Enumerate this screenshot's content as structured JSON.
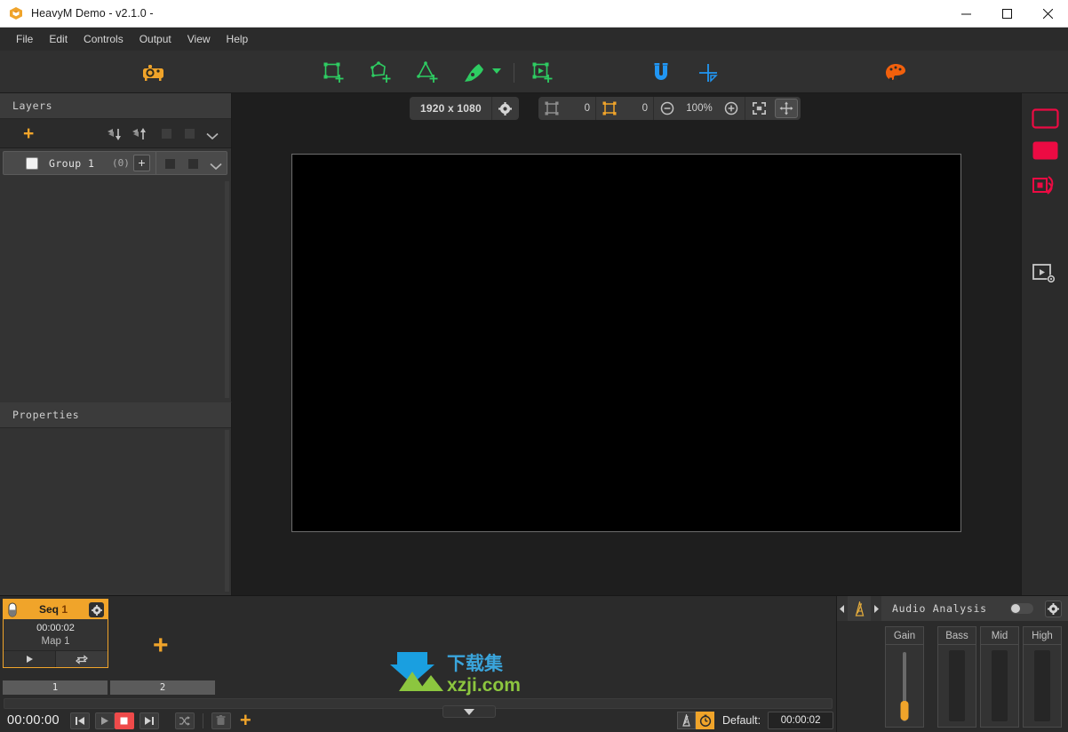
{
  "window": {
    "title": "HeavyM Demo - v2.1.0 -",
    "logo_icon": "heavym-logo-icon",
    "controls": [
      {
        "name": "minimize-button",
        "icon": "minimize-icon"
      },
      {
        "name": "maximize-button",
        "icon": "maximize-icon"
      },
      {
        "name": "close-button",
        "icon": "close-icon"
      }
    ]
  },
  "menubar": {
    "items": [
      {
        "label": "File"
      },
      {
        "label": "Edit"
      },
      {
        "label": "Controls"
      },
      {
        "label": "Output"
      },
      {
        "label": "View"
      },
      {
        "label": "Help"
      }
    ]
  },
  "toolbar": {
    "items": [
      {
        "name": "projector-button",
        "icon": "projector-icon",
        "color": "#f0a42a"
      },
      {
        "name": "add-rectangle-button",
        "icon": "rectangle-plus-icon",
        "color": "#2ecc62"
      },
      {
        "name": "add-polygon-button",
        "icon": "polygon-plus-icon",
        "color": "#2ecc62"
      },
      {
        "name": "add-triangle-button",
        "icon": "triangle-plus-icon",
        "color": "#2ecc62"
      },
      {
        "name": "pen-tool-button",
        "icon": "pen-icon",
        "color": "#2ecc62"
      },
      {
        "name": "pen-tool-dropdown",
        "icon": "chevron-down-icon",
        "color": "#2ecc62"
      },
      {
        "name": "add-media-surface-button",
        "icon": "media-rectangle-plus-icon",
        "color": "#2ecc62"
      },
      {
        "name": "snap-button",
        "icon": "magnet-icon",
        "color": "#2196f3"
      },
      {
        "name": "guides-button",
        "icon": "crosshair-icon",
        "color": "#2196f3"
      },
      {
        "name": "palette-button",
        "icon": "palette-icon",
        "color": "#f2600c"
      }
    ]
  },
  "layers_panel": {
    "title": "Layers",
    "toolbar": {
      "add_label": "+",
      "move_down_icon": "send-backward-icon",
      "move_up_icon": "bring-forward-icon",
      "toggle_a_icon": "square-toggle-icon",
      "toggle_b_icon": "square-toggle-icon",
      "expand_icon": "chevron-down-icon"
    },
    "groups": [
      {
        "name": "Group 1",
        "count": "(0)",
        "add_label": "+",
        "checkbox_checked": false
      }
    ]
  },
  "properties_panel": {
    "title": "Properties"
  },
  "view_bar": {
    "resolution": "1920 x 1080",
    "resolution_settings_icon": "gear-icon",
    "surface_count": "0",
    "group_count": "0",
    "zoom_out_icon": "zoom-out-icon",
    "zoom_level": "100%",
    "zoom_in_icon": "zoom-in-icon",
    "fit_icon": "fit-to-screen-icon",
    "pan_icon": "pan-move-icon"
  },
  "right_rail": {
    "items": [
      {
        "name": "outline-shape-button",
        "icon": "rectangle-outline-icon",
        "color": "#ec0b43"
      },
      {
        "name": "filled-shape-button",
        "icon": "rectangle-filled-icon",
        "color": "#ec0b43"
      },
      {
        "name": "effects-button",
        "icon": "motion-effect-icon",
        "color": "#ec0b43"
      },
      {
        "name": "media-settings-button",
        "icon": "media-settings-icon",
        "color": "#c8c8c8"
      }
    ]
  },
  "sequences": {
    "cards": [
      {
        "title_prefix": "Seq",
        "title_number": "1",
        "duration": "00:00:02",
        "map": "Map 1",
        "play_icon": "play-icon",
        "loop_icon": "loop-icon",
        "gear_icon": "gear-icon",
        "mode_icon": "sequence-mode-icon"
      }
    ],
    "add_label": "+",
    "tabs": [
      {
        "label": "1"
      },
      {
        "label": "2"
      }
    ],
    "collapse_icon": "triangle-down-icon"
  },
  "transport": {
    "timecode": "00:00:00",
    "buttons": [
      {
        "name": "previous-button",
        "icon": "skip-previous-icon"
      },
      {
        "name": "play-button",
        "icon": "play-icon"
      },
      {
        "name": "stop-button",
        "icon": "stop-icon",
        "color": "#ef4a4a"
      },
      {
        "name": "next-button",
        "icon": "skip-next-icon"
      },
      {
        "name": "shuffle-button",
        "icon": "shuffle-icon"
      },
      {
        "name": "delete-button",
        "icon": "trash-icon"
      },
      {
        "name": "add-button",
        "icon": "plus-icon"
      }
    ],
    "default_section": {
      "metronome_icon": "metronome-icon",
      "clock_icon": "clock-icon",
      "label": "Default:",
      "value": "00:00:02"
    }
  },
  "audio_analysis": {
    "title": "Audio Analysis",
    "collapse_left_icon": "chevron-left-icon",
    "collapse_right_icon": "chevron-right-icon",
    "metronome_icon": "metronome-icon",
    "enabled": false,
    "gear_icon": "gear-icon",
    "channels": [
      {
        "label": "Gain",
        "type": "slider",
        "value": 18
      },
      {
        "label": "Bass",
        "type": "meter",
        "value": 0
      },
      {
        "label": "Mid",
        "type": "meter",
        "value": 0
      },
      {
        "label": "High",
        "type": "meter",
        "value": 0
      }
    ]
  },
  "watermark": {
    "cn_text": "下载集",
    "url_text": "xzji.com"
  },
  "colors": {
    "accent_orange": "#f0a42a",
    "tool_green": "#2ecc62",
    "tool_blue": "#2196f3",
    "rail_red": "#ec0b43",
    "stop_red": "#ef4a4a"
  }
}
